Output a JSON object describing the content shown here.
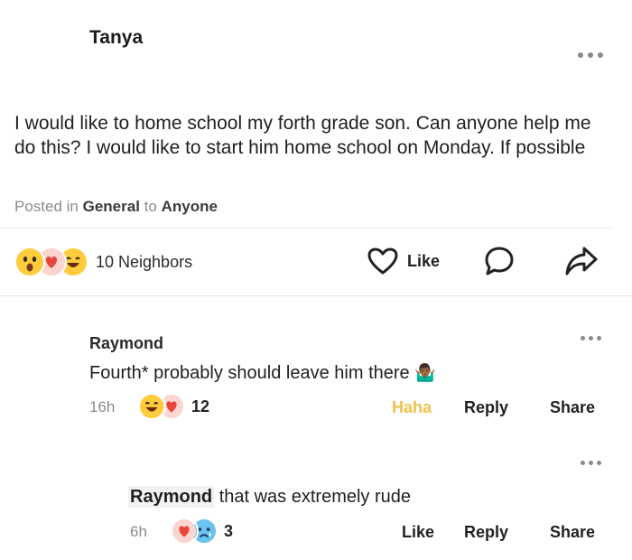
{
  "post": {
    "author": "Tanya",
    "body": "I would like to home school my forth grade son. Can anyone help me do this? I would like to start him home school on Monday. If possible",
    "posted_prefix": "Posted in",
    "category": "General",
    "to_word": "to",
    "audience": "Anyone",
    "reactions_label": "10 Neighbors",
    "reaction_icons": [
      "wow-emoji",
      "heart-emoji",
      "laugh-emoji"
    ],
    "like_label": "Like"
  },
  "comments": [
    {
      "name": "Raymond",
      "text": "Fourth* probably should leave him there",
      "emoji": "🤷🏾‍♂️",
      "time": "16h",
      "reaction_count": "12",
      "reaction_icons": [
        "laugh-emoji",
        "heart-emoji"
      ],
      "reaction_btn": "Haha",
      "reply_label": "Reply",
      "share_label": "Share"
    },
    {
      "name": "Raymond",
      "text": "that was extremely rude",
      "time": "6h",
      "reaction_count": "3",
      "reaction_icons": [
        "heart-emoji",
        "sad-emoji"
      ],
      "reaction_btn": "Like",
      "reply_label": "Reply",
      "share_label": "Share"
    }
  ],
  "colors": {
    "haha_active": "#f0c24a",
    "meta_gray": "#8a8a8a"
  }
}
